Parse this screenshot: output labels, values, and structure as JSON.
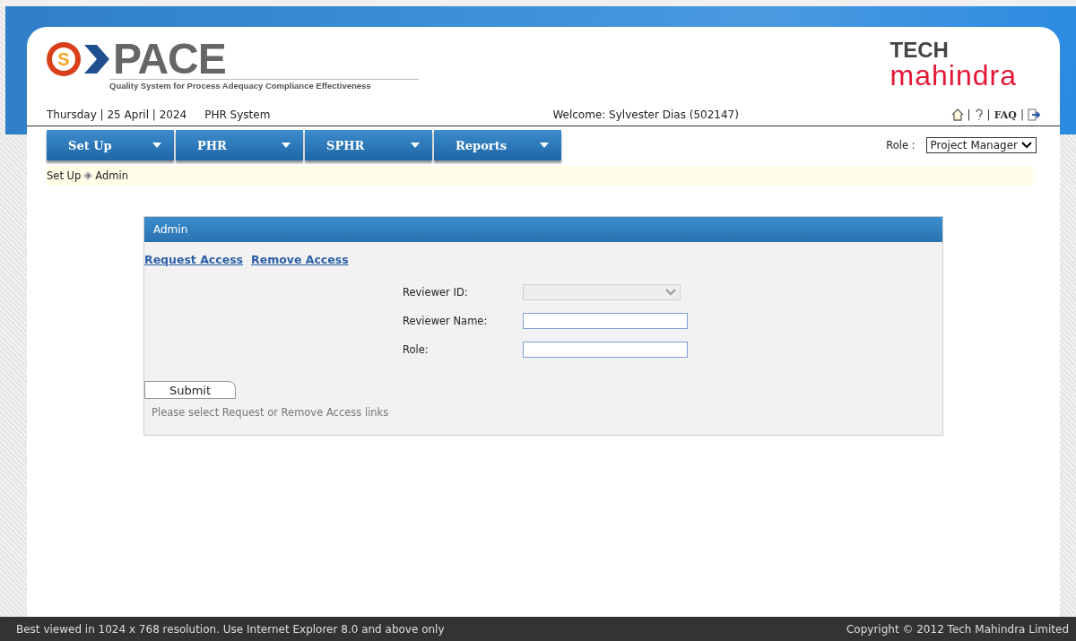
{
  "logo": {
    "letter": "S",
    "word": "PACE",
    "tagline": "Quality System for Process Adequacy Compliance Effectiveness"
  },
  "brand": {
    "line1": "TECH",
    "line2": "mahindra"
  },
  "info_bar": {
    "date": "Thursday | 25 April | 2024",
    "system": "PHR System",
    "welcome": "Welcome: Sylvester Dias (502147)",
    "separator": "|",
    "faq": "FAQ"
  },
  "menu": [
    {
      "label": "Set Up"
    },
    {
      "label": "PHR"
    },
    {
      "label": "SPHR"
    },
    {
      "label": "Reports"
    }
  ],
  "role": {
    "label": "Role :",
    "value": "Project Manager"
  },
  "breadcrumb": [
    "Set Up",
    "Admin"
  ],
  "panel": {
    "title": "Admin",
    "links": [
      "Request Access",
      "Remove Access"
    ],
    "fields": [
      {
        "kind": "select",
        "label": "Reviewer ID:",
        "disabled": true
      },
      {
        "kind": "text",
        "label": "Reviewer Name:",
        "disabled": false
      },
      {
        "kind": "text",
        "label": "Role:",
        "disabled": false
      }
    ],
    "submit": "Submit",
    "message": "Please select Request or Remove Access links"
  },
  "footer": {
    "left": "Best viewed in 1024 x 768 resolution. Use Internet Explorer 8.0 and above only",
    "right": "Copyright © 2012 Tech Mahindra Limited"
  }
}
